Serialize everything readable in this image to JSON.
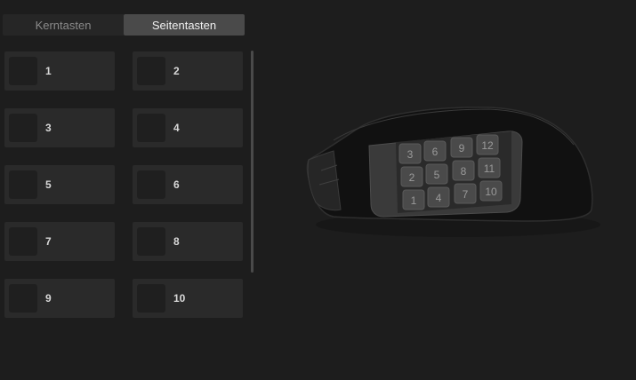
{
  "tabs": [
    {
      "label": "Kerntasten",
      "active": false
    },
    {
      "label": "Seitentasten",
      "active": true
    }
  ],
  "keys": [
    "1",
    "2",
    "3",
    "4",
    "5",
    "6",
    "7",
    "8",
    "9",
    "10"
  ],
  "mouse_side_buttons": [
    "3",
    "6",
    "9",
    "12",
    "2",
    "5",
    "8",
    "11",
    "1",
    "4",
    "7",
    "10"
  ]
}
